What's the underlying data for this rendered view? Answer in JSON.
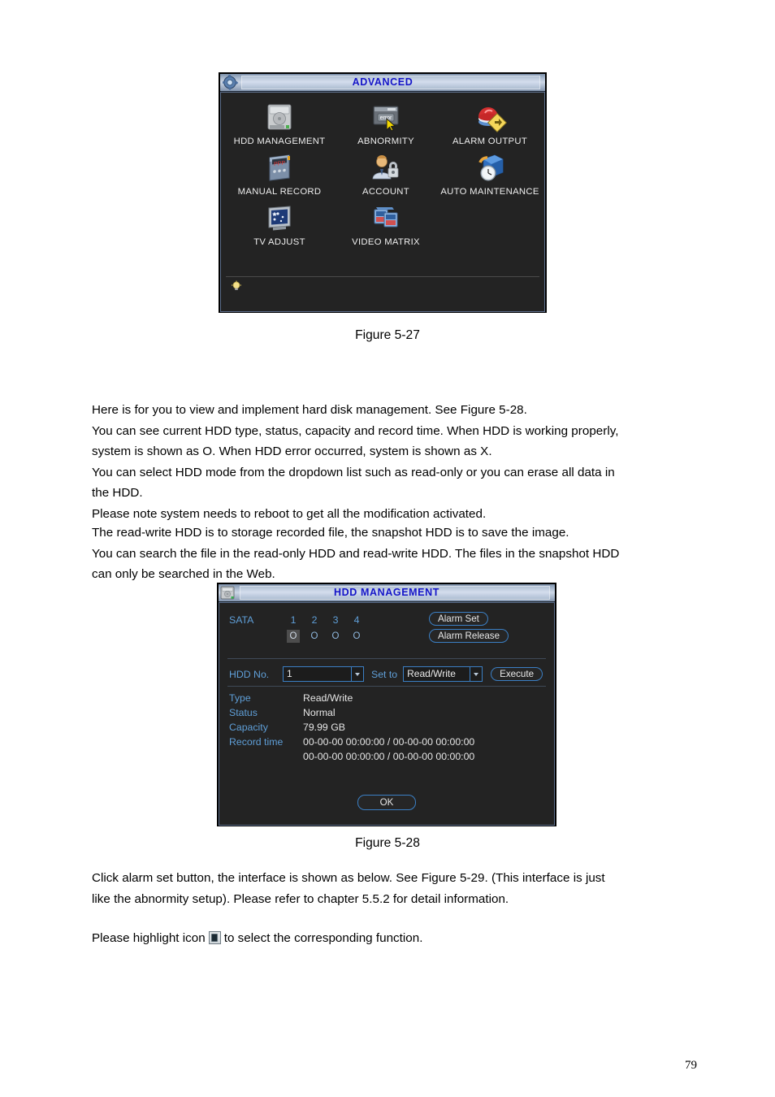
{
  "document": {
    "page_number": "79"
  },
  "figure_5_27": {
    "caption": "Figure 5-27",
    "dialog": {
      "title": "ADVANCED",
      "title_icon": "gear-icon",
      "menu_items": [
        {
          "label": "HDD MANAGEMENT",
          "icon": "hard-disk-icon"
        },
        {
          "label": "ABNORMITY",
          "icon": "error-dialog-icon"
        },
        {
          "label": "ALARM OUTPUT",
          "icon": "alarm-siren-icon"
        },
        {
          "label": "MANUAL RECORD",
          "icon": "record-panel-icon"
        },
        {
          "label": "ACCOUNT",
          "icon": "user-lock-icon"
        },
        {
          "label": "AUTO MAINTENANCE",
          "icon": "box-clock-icon"
        },
        {
          "label": "TV ADJUST",
          "icon": "tv-screen-icon"
        },
        {
          "label": "VIDEO MATRIX",
          "icon": "video-matrix-icon"
        }
      ],
      "hint_icon": "light-bulb-icon"
    }
  },
  "figure_5_28": {
    "caption": "Figure 5-28",
    "dialog": {
      "title": "HDD MANAGEMENT",
      "title_icon": "hard-disk-icon",
      "sata": {
        "label": "SATA",
        "numbers": [
          "1",
          "2",
          "3",
          "4"
        ],
        "states": [
          "O",
          "O",
          "O",
          "O"
        ],
        "selected_index": 0
      },
      "alarm_set_button": "Alarm Set",
      "alarm_release_button": "Alarm Release",
      "hdd_no": {
        "label": "HDD No.",
        "value": "1"
      },
      "set_to": {
        "label": "Set to",
        "value": "Read/Write"
      },
      "execute_button": "Execute",
      "properties": [
        {
          "key": "Type",
          "value": "Read/Write"
        },
        {
          "key": "Status",
          "value": "Normal"
        },
        {
          "key": "Capacity",
          "value": "79.99 GB"
        }
      ],
      "record_time": {
        "key": "Record time",
        "lines": [
          "00-00-00 00:00:00 / 00-00-00 00:00:00",
          "00-00-00 00:00:00 / 00-00-00 00:00:00"
        ]
      },
      "ok_button": "OK"
    }
  },
  "body_text": {
    "paragraph_1": [
      "Here is for you to view and implement hard disk management. See Figure 5-28.",
      "You can see current HDD type, status, capacity and record time. When HDD is working properly,",
      "system is shown as O. When HDD error occurred, system is shown as X.",
      "You can select HDD mode from the dropdown list such as read-only or you can erase all data in",
      "the HDD.",
      "Please note system needs to reboot to get all the modification activated."
    ],
    "paragraph_2": [
      "The read-write HDD is to storage recorded file, the snapshot HDD is to save the image.",
      "You can search the file in the read-only HDD and read-write HDD. The files in the snapshot HDD",
      "can only be searched in the Web."
    ],
    "paragraph_3": [
      "Click alarm set button, the interface is shown as below. See Figure 5-29. (This interface is just",
      "like the abnormity setup). Please refer to chapter 5.5.2 for detail information."
    ],
    "paragraph_4_before": "Please highlight icon",
    "paragraph_4_after": "to select the corresponding function."
  },
  "colors": {
    "dialog_background": "#232323",
    "title_text": "#1515c8",
    "label_blue": "#5f9fd8",
    "value_white": "#e6e6e6",
    "accent_border": "#3b7fc4"
  }
}
